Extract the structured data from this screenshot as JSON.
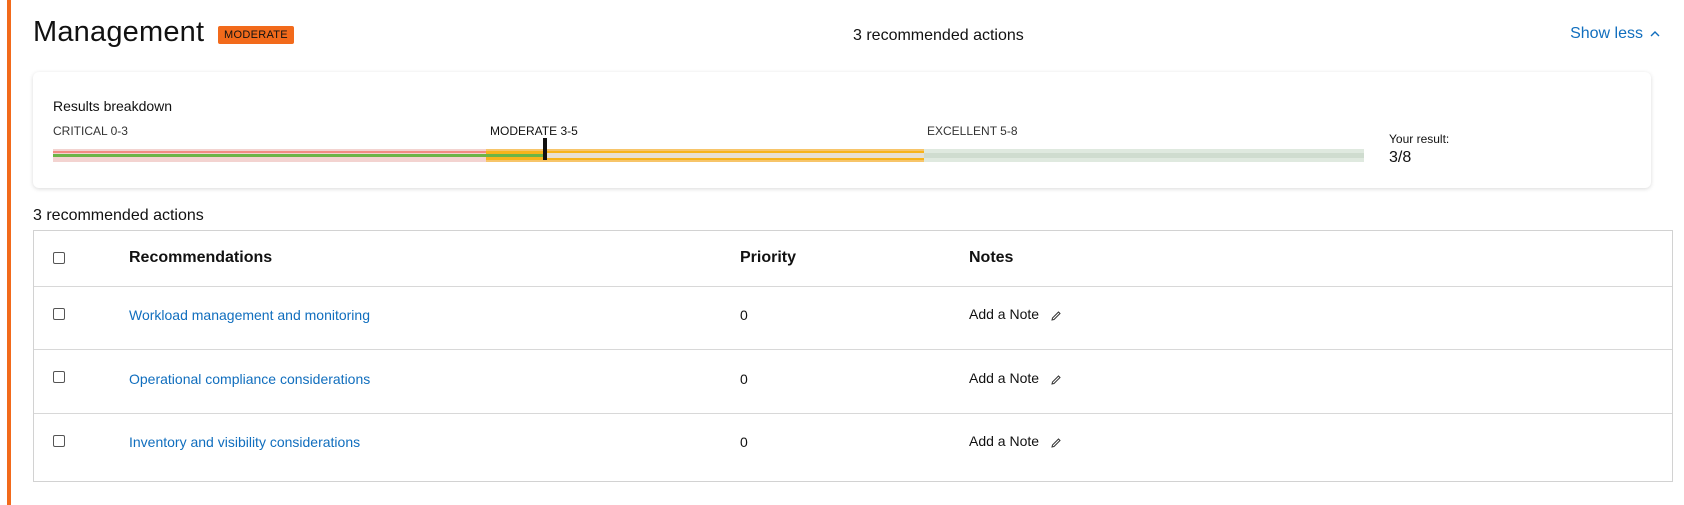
{
  "section": {
    "title": "Management",
    "badge": "MODERATE",
    "summary": "3 recommended actions",
    "toggle_label": "Show less",
    "accent_color": "#f26a1b"
  },
  "breakdown": {
    "title": "Results breakdown",
    "segments": [
      {
        "label": "CRITICAL 0-3",
        "range": [
          0,
          3
        ],
        "color": "#f3d3d0"
      },
      {
        "label": "MODERATE 3-5",
        "range": [
          3,
          5
        ],
        "color": "#f7b41b"
      },
      {
        "label": "EXCELLENT 5-8",
        "range": [
          5,
          8
        ],
        "color": "#dfe9df"
      }
    ],
    "result_label": "Your result:",
    "result_value": "3/8",
    "result_numeric": 3,
    "max": 8
  },
  "actions": {
    "heading": "3 recommended actions",
    "columns": {
      "recommendation": "Recommendations",
      "priority": "Priority",
      "notes": "Notes"
    },
    "rows": [
      {
        "title": "Workload management and monitoring",
        "priority": "0",
        "note": "Add a Note"
      },
      {
        "title": "Operational compliance considerations",
        "priority": "0",
        "note": "Add a Note"
      },
      {
        "title": "Inventory and visibility considerations",
        "priority": "0",
        "note": "Add a Note"
      }
    ]
  },
  "icons": {
    "toggle": "chevron-up-icon",
    "note": "pencil-icon"
  }
}
